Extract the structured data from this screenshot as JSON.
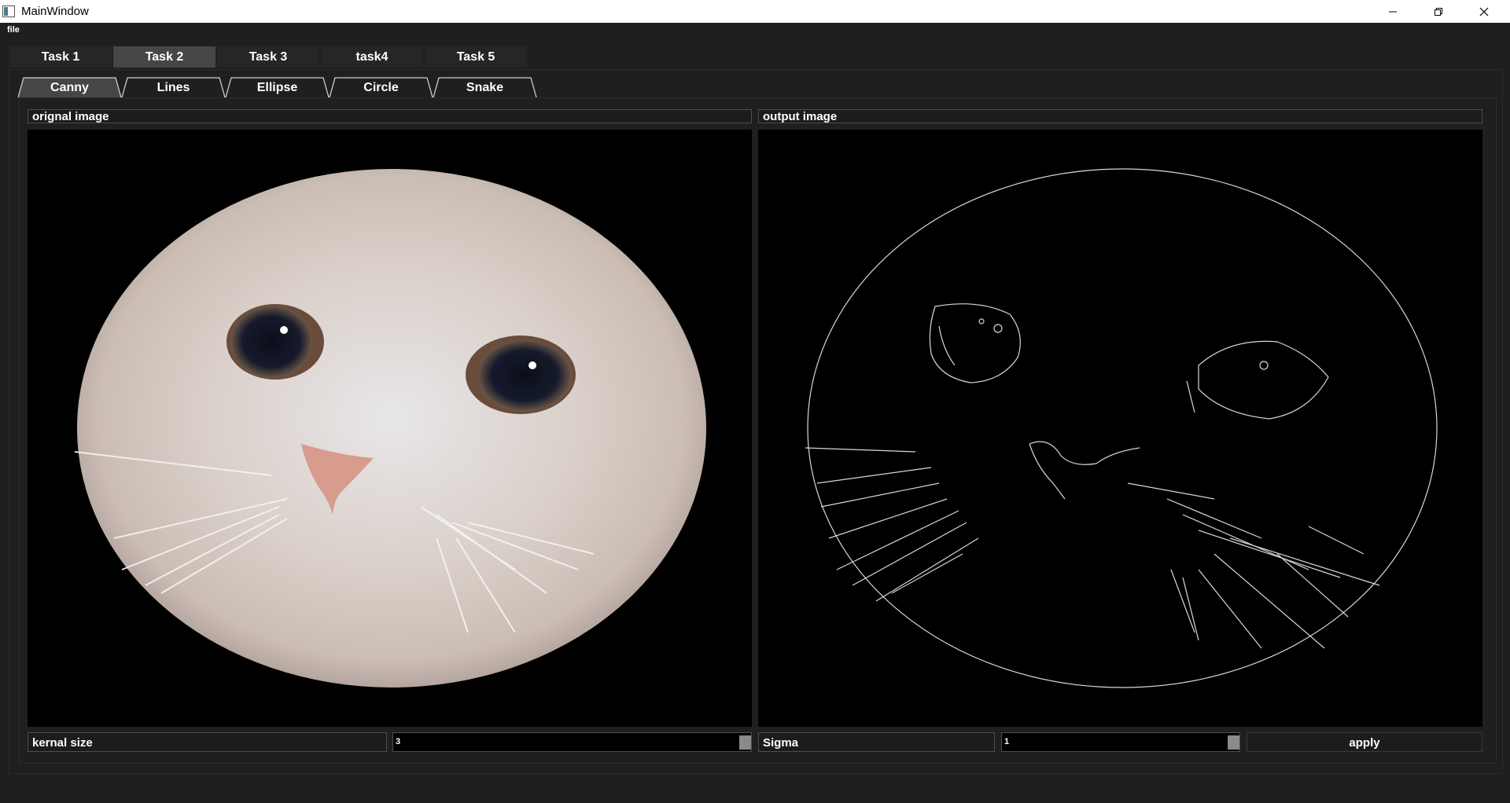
{
  "window": {
    "title": "MainWindow"
  },
  "menu": {
    "file": "file"
  },
  "tabs": [
    "Task 1",
    "Task 2",
    "Task 3",
    "task4",
    "Task 5"
  ],
  "active_tab": "Task 2",
  "sub_tabs": [
    "Canny",
    "Lines",
    "Ellipse",
    "Circle",
    "Snake"
  ],
  "active_sub_tab": "Canny",
  "panels": {
    "original_label": "orignal image",
    "output_label": "output image"
  },
  "controls": {
    "kernel_label": "kernal size",
    "kernel_value": "3",
    "sigma_label": "Sigma",
    "sigma_value": "1",
    "apply_label": "apply"
  },
  "colors": {
    "background": "#1f1f1f",
    "active_tab": "#464646",
    "image_bg": "#000000"
  }
}
